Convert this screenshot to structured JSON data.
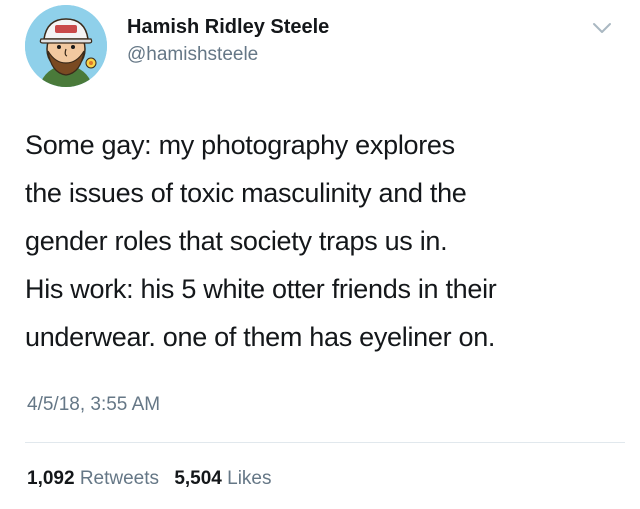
{
  "author": {
    "display_name": "Hamish Ridley Steele",
    "handle": "@hamishsteele",
    "avatar_icon": "cartoon-avatar-with-cap",
    "menu_icon": "chevron-down-icon"
  },
  "tweet": {
    "lines": [
      "Some gay: my photography explores",
      "the issues of toxic masculinity and the",
      "gender roles that society traps us in.",
      "His work: his 5 white otter friends in their",
      "underwear. one of them has eyeliner on."
    ],
    "timestamp": "4/5/18, 3:55 AM"
  },
  "stats": {
    "retweets": {
      "count": "1,092",
      "label": "Retweets"
    },
    "likes": {
      "count": "5,504",
      "label": "Likes"
    }
  },
  "colors": {
    "text_primary": "#14171a",
    "text_secondary": "#657786",
    "divider": "#e1e8ed",
    "avatar_bg": "#8fd0ea"
  }
}
